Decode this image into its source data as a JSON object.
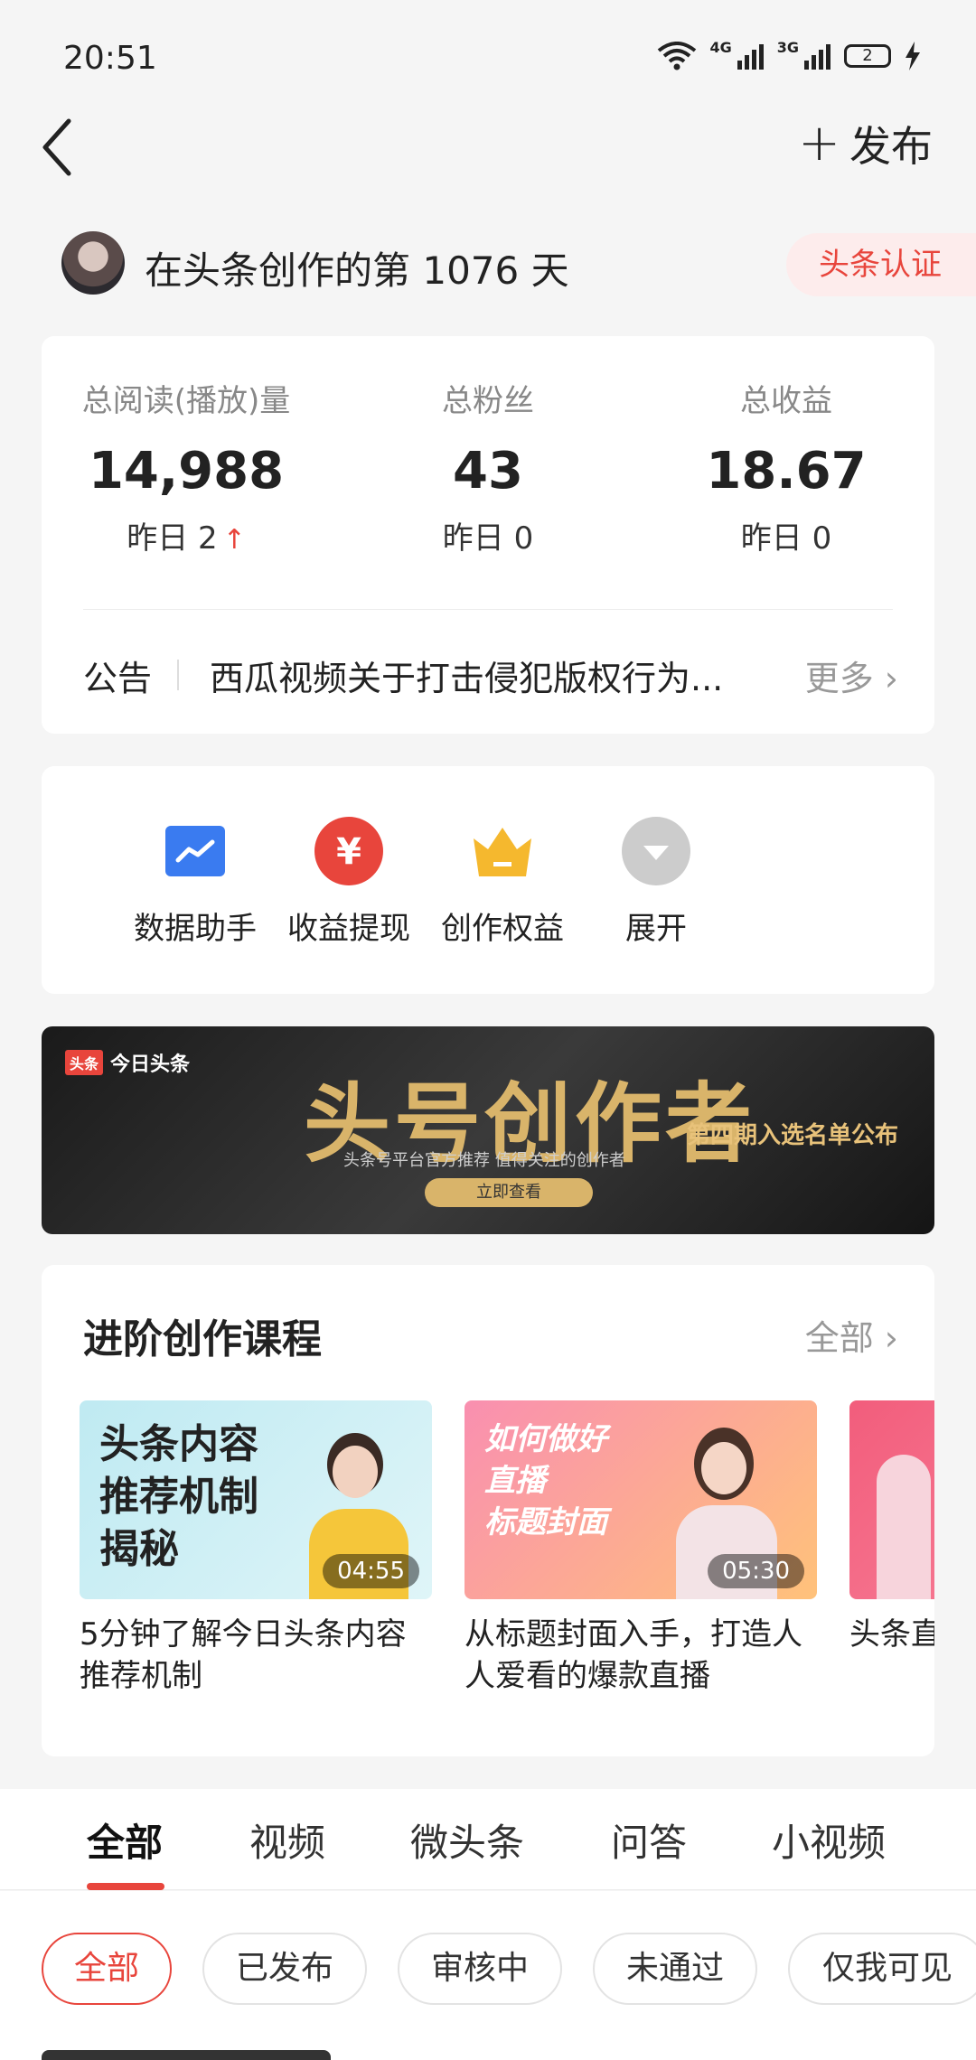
{
  "status": {
    "time": "20:51",
    "net1": "4G",
    "net2": "3G",
    "battery": "2"
  },
  "header": {
    "publish_label": "发布"
  },
  "profile": {
    "days_text": "在头条创作的第 1076 天",
    "certification": "头条认证"
  },
  "stats": [
    {
      "label": "总阅读(播放)量",
      "value": "14,988",
      "yesterday": "昨日 2"
    },
    {
      "label": "总粉丝",
      "value": "43",
      "yesterday": "昨日 0"
    },
    {
      "label": "总收益",
      "value": "18.67",
      "yesterday": "昨日 0"
    }
  ],
  "notice": {
    "label": "公告",
    "text": "西瓜视频关于打击侵犯版权行为...",
    "more": "更多"
  },
  "tools": [
    {
      "label": "数据助手",
      "icon": "chart-icon",
      "color": "#3a7bf0"
    },
    {
      "label": "收益提现",
      "icon": "yuan-icon",
      "color": "#e8453c"
    },
    {
      "label": "创作权益",
      "icon": "crown-icon",
      "color": "#f5b82e"
    },
    {
      "label": "展开",
      "icon": "expand-icon",
      "color": "#cccccc"
    }
  ],
  "banner": {
    "brand": "今日头条",
    "brand_box": "头条",
    "title": "头号创作者",
    "subtitle": "头条号平台官方推荐 值得关注的创作者",
    "button": "立即查看",
    "right_text": "第四期入选名单公布"
  },
  "courses": {
    "title": "进阶创作课程",
    "all_label": "全部",
    "items": [
      {
        "thumb_title": "头条内容\n推荐机制\n揭秘",
        "duration": "04:55",
        "caption": "5分钟了解今日头条内容推荐机制"
      },
      {
        "thumb_title": "如何做好\n直播\n标题封面",
        "duration": "05:30",
        "caption": "从标题封面入手，打造人人爱看的爆款直播"
      },
      {
        "thumb_title": "",
        "duration": "",
        "caption": "头条直播小白到"
      }
    ]
  },
  "tabs": [
    "全部",
    "视频",
    "微头条",
    "问答",
    "小视频"
  ],
  "filters": [
    "全部",
    "已发布",
    "审核中",
    "未通过",
    "仅我可见"
  ]
}
